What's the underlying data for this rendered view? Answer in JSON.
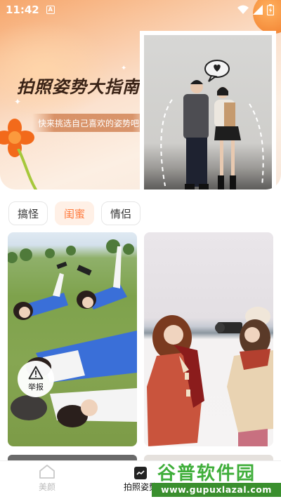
{
  "status_bar": {
    "time": "11:42",
    "notification_badge": "A"
  },
  "banner": {
    "title": "拍照姿势大指南",
    "subtitle": "快来挑选自己喜欢的姿势吧",
    "photo_icon": "speech-bubble-heart-icon"
  },
  "tabs": [
    {
      "label": "搞怪",
      "active": false
    },
    {
      "label": "闺蜜",
      "active": true
    },
    {
      "label": "情侣",
      "active": false
    }
  ],
  "cards": [
    {
      "name": "friends-lying-on-grass-photo"
    },
    {
      "name": "friends-in-snow-photo"
    }
  ],
  "report_button": {
    "label": "举报",
    "icon": "warning-triangle-icon"
  },
  "bottom_nav": {
    "items": [
      {
        "label": "美颜",
        "icon": "home-icon",
        "active": false
      },
      {
        "label": "拍照姿势",
        "icon": "pose-icon",
        "active": true
      }
    ]
  },
  "watermark": {
    "title": "谷普软件园",
    "url": "www.gupuxlazal.com"
  },
  "colors": {
    "accent": "#ff7a3d",
    "active_tab_bg": "#fff0e6",
    "watermark_green": "#3fae3a"
  }
}
